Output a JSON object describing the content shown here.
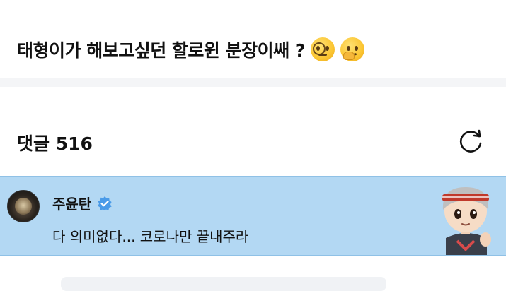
{
  "post": {
    "title": "태형이가 해보고싶던 할로윈 분장이쌔 ?",
    "emojis": [
      "face-with-monocle",
      "thinking-face"
    ]
  },
  "comments": {
    "header": "댓글 516",
    "refresh_icon": "refresh-icon",
    "items": [
      {
        "author": "주윤탄",
        "verified": true,
        "text": "다 의미없다... 코로나만 끝내주라",
        "highlight_color": "#b3d8f3"
      }
    ]
  }
}
